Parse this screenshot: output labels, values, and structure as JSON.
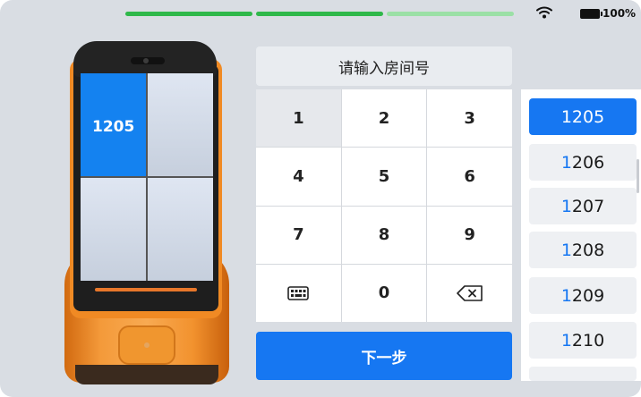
{
  "status_bar": {
    "progress_segments": [
      {
        "state": "complete",
        "color": "#2fb84a"
      },
      {
        "state": "complete",
        "color": "#2fb84a"
      },
      {
        "state": "pending",
        "color": "#9be0a6"
      }
    ],
    "wifi_icon": "wifi-icon",
    "battery_icon": "battery-icon",
    "battery_text": "100%"
  },
  "robot": {
    "active_door_label": "1205",
    "accent_color": "#f08a24",
    "active_door_color": "#1482f0"
  },
  "input": {
    "title": "请输入房间号"
  },
  "keypad": {
    "keys": [
      {
        "label": "1",
        "type": "digit",
        "pressed": true
      },
      {
        "label": "2",
        "type": "digit"
      },
      {
        "label": "3",
        "type": "digit"
      },
      {
        "label": "4",
        "type": "digit"
      },
      {
        "label": "5",
        "type": "digit"
      },
      {
        "label": "6",
        "type": "digit"
      },
      {
        "label": "7",
        "type": "digit"
      },
      {
        "label": "8",
        "type": "digit"
      },
      {
        "label": "9",
        "type": "digit"
      },
      {
        "label": "",
        "type": "keyboard",
        "icon": "keyboard-icon"
      },
      {
        "label": "0",
        "type": "digit"
      },
      {
        "label": "",
        "type": "backspace",
        "icon": "backspace-icon"
      }
    ]
  },
  "actions": {
    "next_label": "下一步",
    "primary_color": "#1677f2"
  },
  "room_list": {
    "selected": "1205",
    "items": [
      {
        "prefix": "1",
        "rest": "205",
        "selected": true
      },
      {
        "prefix": "1",
        "rest": "206"
      },
      {
        "prefix": "1",
        "rest": "207"
      },
      {
        "prefix": "1",
        "rest": "208"
      },
      {
        "prefix": "1",
        "rest": "209"
      },
      {
        "prefix": "1",
        "rest": "210"
      }
    ]
  }
}
